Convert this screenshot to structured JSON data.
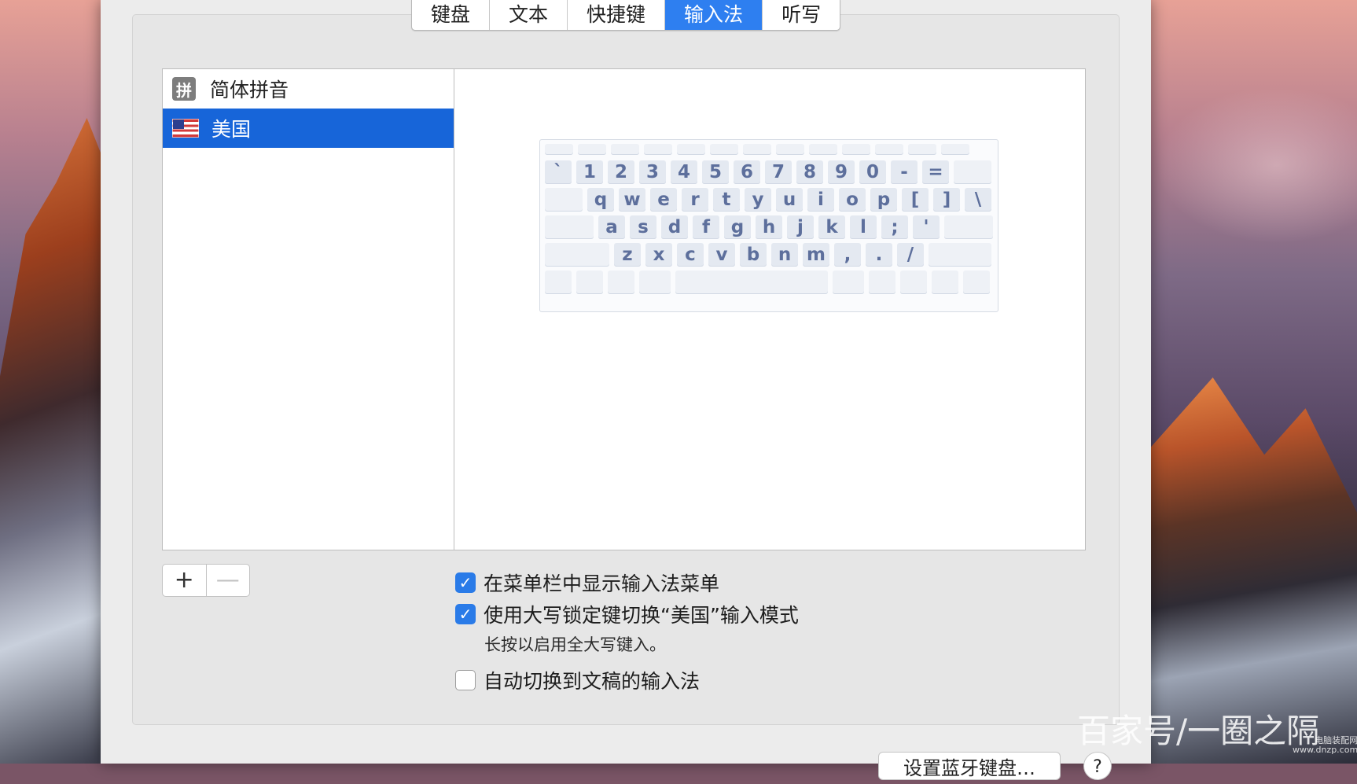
{
  "tabs": [
    {
      "label": "键盘",
      "active": false
    },
    {
      "label": "文本",
      "active": false
    },
    {
      "label": "快捷键",
      "active": false
    },
    {
      "label": "输入法",
      "active": true
    },
    {
      "label": "听写",
      "active": false
    }
  ],
  "input_sources": [
    {
      "label": "简体拼音",
      "icon": "pinyin-icon",
      "icon_glyph": "拼",
      "selected": false
    },
    {
      "label": "美国",
      "icon": "us-flag-icon",
      "selected": true
    }
  ],
  "keyboard_layout": {
    "rows": [
      [
        "`",
        "1",
        "2",
        "3",
        "4",
        "5",
        "6",
        "7",
        "8",
        "9",
        "0",
        "-",
        "="
      ],
      [
        "q",
        "w",
        "e",
        "r",
        "t",
        "y",
        "u",
        "i",
        "o",
        "p",
        "[",
        "]",
        "\\"
      ],
      [
        "a",
        "s",
        "d",
        "f",
        "g",
        "h",
        "j",
        "k",
        "l",
        ";",
        "'"
      ],
      [
        "z",
        "x",
        "c",
        "v",
        "b",
        "n",
        "m",
        ",",
        ".",
        "/"
      ]
    ]
  },
  "list_controls": {
    "add_label": "+",
    "remove_label": "—"
  },
  "options": {
    "show_menu": {
      "label": "在菜单栏中显示输入法菜单",
      "checked": true
    },
    "caps_lock": {
      "label": "使用大写锁定键切换“美国”输入模式",
      "checked": true,
      "hint": "长按以启用全大写键入。"
    },
    "auto_switch": {
      "label": "自动切换到文稿的输入法",
      "checked": false
    }
  },
  "footer": {
    "setup_keyboard_label": "设置蓝牙键盘…",
    "help_label": "?"
  },
  "watermark": {
    "text": "百家号/一圈之隔",
    "small_top": "电脑装配网",
    "small_bottom": "www.dnzp.com"
  },
  "colors": {
    "accent": "#2e7ff0",
    "selection": "#1765d9",
    "key_text": "#5d6f9c"
  }
}
